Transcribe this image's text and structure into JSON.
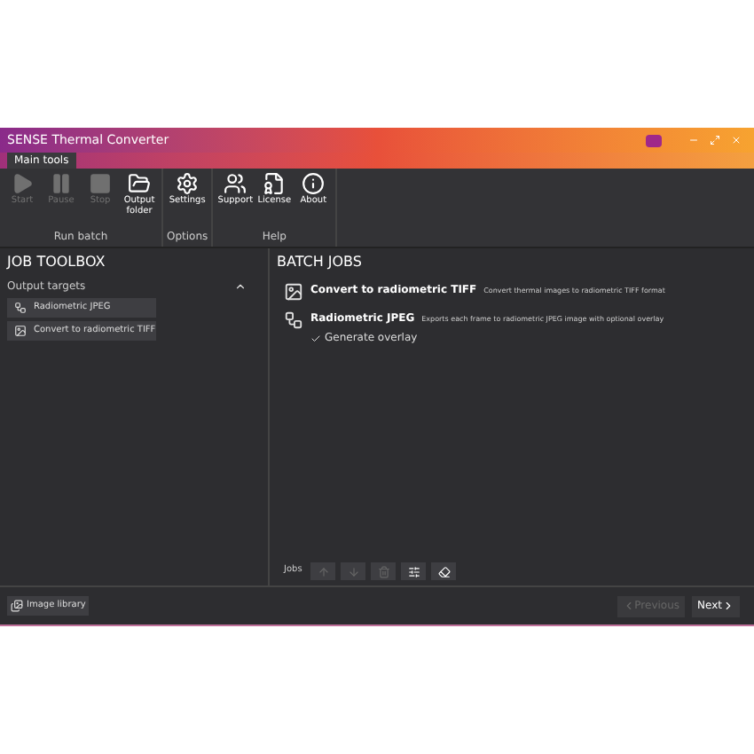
{
  "window": {
    "title": "SENSE Thermal Converter"
  },
  "tabs": [
    {
      "label": "Main tools",
      "selected": true
    }
  ],
  "ribbon": [
    {
      "label": "Run batch",
      "buttons": [
        {
          "kind": "play",
          "label": "Start",
          "disabled": true
        },
        {
          "kind": "pause",
          "label": "Pause",
          "disabled": true
        },
        {
          "kind": "stop",
          "label": "Stop",
          "disabled": true
        },
        {
          "kind": "folder",
          "label": "Output folder",
          "disabled": false
        }
      ]
    },
    {
      "label": "Options",
      "buttons": [
        {
          "kind": "gear",
          "label": "Settings",
          "disabled": false
        }
      ]
    },
    {
      "label": "Help",
      "buttons": [
        {
          "kind": "people",
          "label": "Support",
          "disabled": false
        },
        {
          "kind": "license",
          "label": "License",
          "disabled": false
        },
        {
          "kind": "info",
          "label": "About",
          "disabled": false
        }
      ]
    }
  ],
  "job_toolbox": {
    "title": "JOB TOOLBOX",
    "section": {
      "title": "Output targets",
      "expanded": true
    },
    "items": [
      {
        "kind": "nodes",
        "label": "Radiometric JPEG"
      },
      {
        "kind": "image",
        "label": "Convert to radiometric TIFF"
      }
    ]
  },
  "batch_jobs": {
    "title": "BATCH JOBS",
    "jobs": [
      {
        "kind": "image",
        "title": "Convert to radiometric TIFF",
        "description": "Convert thermal images to radiometric TIFF format"
      },
      {
        "kind": "nodes",
        "title": "Radiometric JPEG",
        "description": "Exports each frame to radiometric JPEG image with optional overlay",
        "options": [
          {
            "label": "Generate overlay",
            "checked": true
          }
        ]
      }
    ]
  },
  "jobs_toolbar": {
    "label": "Jobs",
    "buttons": [
      {
        "kind": "up",
        "disabled": true
      },
      {
        "kind": "down",
        "disabled": true
      },
      {
        "kind": "trash",
        "disabled": true
      },
      {
        "kind": "sliders",
        "disabled": false
      },
      {
        "kind": "eraser",
        "disabled": false
      }
    ]
  },
  "footer": {
    "image_library": "Image library",
    "previous": {
      "label": "Previous",
      "disabled": true
    },
    "next": {
      "label": "Next",
      "disabled": false
    }
  }
}
